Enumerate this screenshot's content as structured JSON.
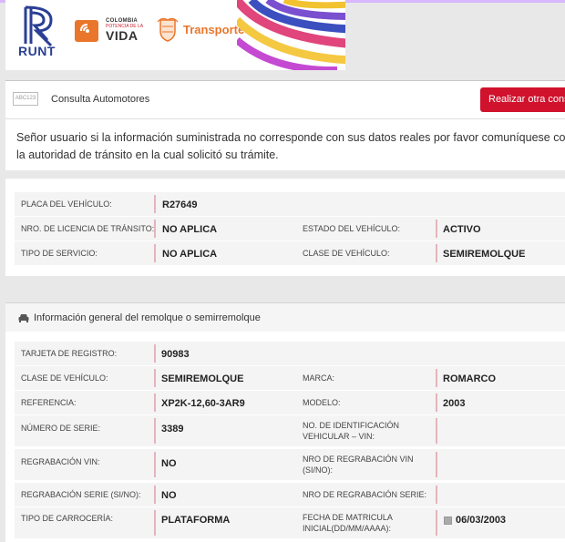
{
  "header": {
    "runt_label": "RUNT",
    "colombia_line1": "COLOMBIA",
    "colombia_line2": "POTENCIA DE LA",
    "colombia_line3": "VIDA",
    "transporte_label": "Transporte"
  },
  "toolbar": {
    "captcha_label": "ABC123",
    "title": "Consulta Automotores",
    "new_query_label": "Realizar otra consulta"
  },
  "notice": "Señor usuario si la información suministrada no corresponde con sus datos reales por favor comuníquese con la autoridad de tránsito en la cual solicitó su trámite.",
  "vehicle": {
    "placa_label": "PLACA DEL VEHÍCULO:",
    "placa_value": "R27649",
    "licencia_label": "NRO. DE LICENCIA DE TRÁNSITO:",
    "licencia_value": "NO APLICA",
    "estado_label": "ESTADO DEL VEHÍCULO:",
    "estado_value": "ACTIVO",
    "servicio_label": "TIPO DE SERVICIO:",
    "servicio_value": "NO APLICA",
    "clase_label": "CLASE DE VEHÍCULO:",
    "clase_value": "SEMIREMOLQUE"
  },
  "trailer": {
    "section_title": "Información general del remolque o semirremolque",
    "tarjeta_label": "TARJETA DE REGISTRO:",
    "tarjeta_value": "90983",
    "clase_label": "CLASE DE VEHÍCULO:",
    "clase_value": "SEMIREMOLQUE",
    "marca_label": "MARCA:",
    "marca_value": "ROMARCO",
    "referencia_label": "REFERENCIA:",
    "referencia_value": "XP2K-12,60-3AR9",
    "modelo_label": "MODELO:",
    "modelo_value": "2003",
    "serie_label": "NÚMERO DE SERIE:",
    "serie_value": "3389",
    "vin_label_1": "NO. DE IDENTIFICACIÓN",
    "vin_label_2": "VEHICULAR – VIN:",
    "vin_value": "",
    "regrab_vin_label": "REGRABACIÓN VIN:",
    "regrab_vin_value": "NO",
    "nro_regrab_vin_label_1": "NRO DE REGRABACIÓN VIN",
    "nro_regrab_vin_label_2": "(SI/NO):",
    "nro_regrab_vin_value": "",
    "regrab_serie_label": "REGRABACIÓN SERIE (SI/NO):",
    "regrab_serie_value": "NO",
    "nro_regrab_serie_label": "NRO DE REGRABACIÓN SERIE:",
    "nro_regrab_serie_value": "",
    "carroceria_label": "TIPO DE CARROCERÍA:",
    "carroceria_value": "PLATAFORMA",
    "fecha_label_1": "FECHA DE MATRICULA",
    "fecha_label_2": "INICIAL(DD/MM/AAAA):",
    "fecha_value": "06/03/2003"
  },
  "colors": {
    "accent_red": "#d0122c",
    "runt_blue": "#2a3f95",
    "transporte_orange": "#e9762b",
    "separator_pink": "#e3b5ba"
  },
  "icons": [
    "runt-logo-icon",
    "colombia-potencia-icon",
    "coat-of-arms-icon",
    "captcha-icon",
    "car-icon",
    "calendar-icon"
  ]
}
